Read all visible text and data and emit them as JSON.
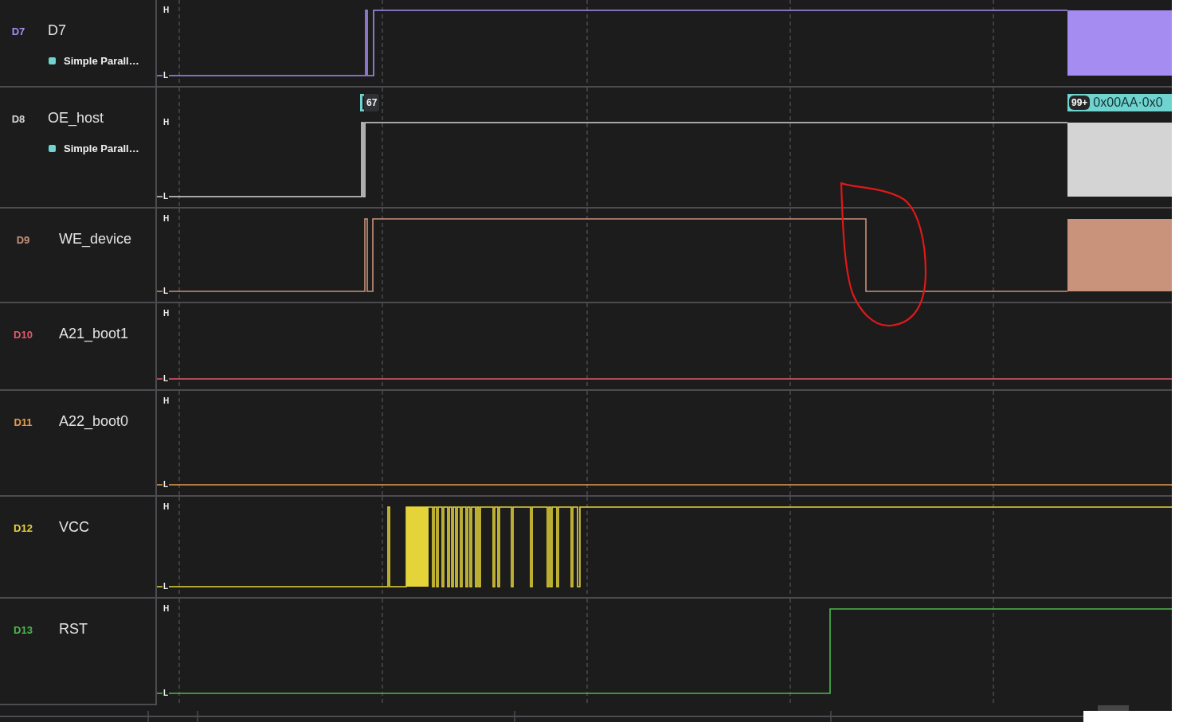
{
  "channels": [
    {
      "id": "D7",
      "name": "D7",
      "color": "#a58cf0",
      "analyzer": {
        "label": "Simple Parall…",
        "color": "#6fd3cf"
      },
      "high_label": "H",
      "low_label": "L"
    },
    {
      "id": "D8",
      "name": "OE_host",
      "color": "#d4d4d4",
      "analyzer": {
        "label": "Simple Parall…",
        "color": "#6fd3cf"
      },
      "high_label": "H",
      "low_label": "L",
      "frames": [
        {
          "kind": "start",
          "text": "67"
        },
        {
          "kind": "data",
          "count": "99+",
          "text": "0x00AA·0x0"
        }
      ]
    },
    {
      "id": "D9",
      "name": "WE_device",
      "color": "#c8937a",
      "high_label": "H",
      "low_label": "L"
    },
    {
      "id": "D10",
      "name": "A21_boot1",
      "color": "#e2596b",
      "high_label": "H",
      "low_label": "L"
    },
    {
      "id": "D11",
      "name": "A22_boot0",
      "color": "#e59a4a",
      "high_label": "H",
      "low_label": "L"
    },
    {
      "id": "D12",
      "name": "VCC",
      "color": "#e4d43a",
      "high_label": "H",
      "low_label": "L"
    },
    {
      "id": "D13",
      "name": "RST",
      "color": "#4cb84e",
      "high_label": "H",
      "low_label": "L"
    }
  ],
  "annotations": [
    {
      "kind": "freehand-loop"
    }
  ]
}
